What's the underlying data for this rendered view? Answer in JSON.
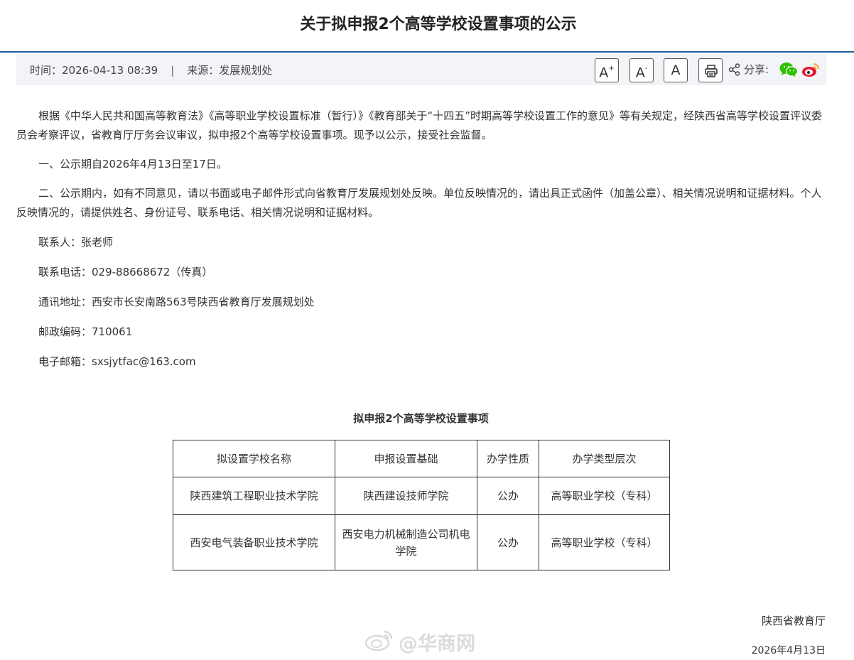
{
  "article": {
    "title": "关于拟申报2个高等学校设置事项的公示"
  },
  "meta": {
    "time_label": "时间：",
    "time_value": "2026-04-13 08:39",
    "separator": "|",
    "source_label": "来源：",
    "source_value": "发展规划处",
    "font_large": "A",
    "font_large_mark": "+",
    "font_small": "A",
    "font_small_mark": "-",
    "font_default": "A",
    "share_label": "分享:"
  },
  "icons": {
    "print": "printer-icon",
    "share": "share-icon",
    "wechat": "wechat-icon",
    "weibo": "weibo-icon"
  },
  "colors": {
    "rule": "#1f5aa0",
    "meta_bg": "#f2f4f8",
    "wechat": "#2dc100",
    "weibo": "#e6162d"
  },
  "body": {
    "p1": "根据《中华人民共和国高等教育法》《高等职业学校设置标准（暂行）》《教育部关于“十四五”时期高等学校设置工作的意见》等有关规定，经陕西省高等学校设置评议委员会考察评议，省教育厅厅务会议审议，拟申报2个高等学校设置事项。现予以公示，接受社会监督。",
    "p2": "一、公示期自2026年4月13日至17日。",
    "p3": "二、公示期内，如有不同意见，请以书面或电子邮件形式向省教育厅发展规划处反映。单位反映情况的，请出具正式函件（加盖公章）、相关情况说明和证据材料。个人反映情况的，请提供姓名、身份证号、联系电话、相关情况说明和证据材料。",
    "contact": "联系人：张老师",
    "phone": "联系电话：029-88668672（传真）",
    "address": "通讯地址：西安市长安南路563号陕西省教育厅发展规划处",
    "postcode": "邮政编码：710061",
    "email": "电子邮箱：sxsjytfac@163.com"
  },
  "table": {
    "caption": "拟申报2个高等学校设置事项",
    "headers": [
      "拟设置学校名称",
      "申报设置基础",
      "办学性质",
      "办学类型层次"
    ],
    "rows": [
      [
        "陕西建筑工程职业技术学院",
        "陕西建设技师学院",
        "公办",
        "高等职业学校（专科）"
      ],
      [
        "西安电气装备职业技术学院",
        "西安电力机械制造公司机电学院",
        "公办",
        "高等职业学校（专科）"
      ]
    ]
  },
  "footer": {
    "signature": "陕西省教育厅",
    "date": "2026年4月13日",
    "watermark": "@华商网"
  }
}
